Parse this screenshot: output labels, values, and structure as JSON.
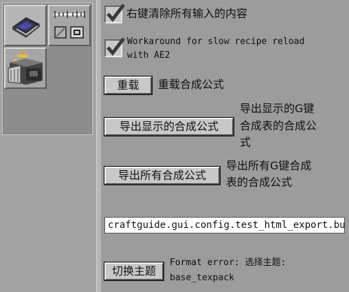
{
  "tabs": [
    {
      "name": "recipe-book-tab",
      "icon": "book-icon"
    },
    {
      "name": "config-tab",
      "icon": "slider-controls-icon"
    },
    {
      "name": "machine-tab",
      "icon": "machine-icon"
    }
  ],
  "settings": {
    "right_click_clear": {
      "checked": true,
      "label": "右键清除所有输入的内容"
    },
    "slow_reload_workaround": {
      "checked": true,
      "label_line1": "Workaround for slow recipe reload",
      "label_line2": "with AE2"
    },
    "reload": {
      "button": "重载",
      "label": "重载合成公式"
    },
    "export_shown": {
      "button": "导出显示的合成公式",
      "label_line1": "导出显示的G键",
      "label_line2": "合成表的合成公",
      "label_line3": "式"
    },
    "export_all": {
      "button": "导出所有合成公式",
      "label_line1": "导出所有G键合成",
      "label_line2": "表的合成公式"
    },
    "html_export_field": {
      "value": "craftguide.gui.config.test_html_export.button"
    },
    "theme": {
      "button": "切换主题",
      "label_line1": "Format error: 选择主题:",
      "label_line2": "base_texpack"
    }
  },
  "colors": {
    "panel": "#9c9c9c",
    "button": "#c8c8c8",
    "check": "#3a3a3a"
  }
}
